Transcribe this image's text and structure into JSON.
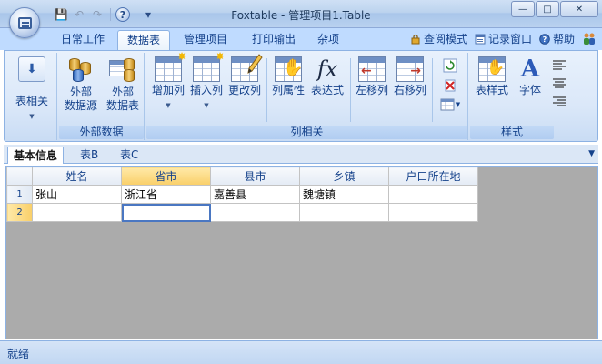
{
  "window": {
    "title": "Foxtable - 管理项目1.Table"
  },
  "window_buttons": {
    "minimize": "—",
    "maximize": "□",
    "close": "✕"
  },
  "qat": {
    "save": "💾",
    "undo": "↶",
    "redo": "↷",
    "help": "?",
    "dropdown": "▾"
  },
  "tabs": [
    {
      "label": "日常工作"
    },
    {
      "label": "数据表"
    },
    {
      "label": "管理项目"
    },
    {
      "label": "打印输出"
    },
    {
      "label": "杂项"
    }
  ],
  "right_links": [
    {
      "label": "查阅模式",
      "icon": "lock-icon"
    },
    {
      "label": "记录窗口",
      "icon": "record-window-icon"
    },
    {
      "label": "帮助",
      "icon": "help-icon"
    }
  ],
  "ribbon": {
    "table_related": {
      "label": "表相关"
    },
    "external": {
      "group_label": "外部数据",
      "source_line1": "外部",
      "source_line2": "数据源",
      "table_line1": "外部",
      "table_line2": "数据表"
    },
    "columns": {
      "group_label": "列相关",
      "add": "增加列",
      "insert": "插入列",
      "modify": "更改列",
      "props": "列属性",
      "expr": "表达式",
      "left": "左移列",
      "right": "右移列",
      "expr_glyph": "fx"
    },
    "style": {
      "group_label": "样式",
      "table_style": "表样式",
      "font": "字体",
      "font_glyph": "A"
    }
  },
  "sheet_tabs": [
    {
      "label": "基本信息"
    },
    {
      "label": "表B"
    },
    {
      "label": "表C"
    }
  ],
  "grid": {
    "columns": [
      "姓名",
      "省市",
      "县市",
      "乡镇",
      "户口所在地"
    ],
    "rows": [
      {
        "num": "1",
        "cells": [
          "张山",
          "浙江省",
          "嘉善县",
          "魏塘镇",
          ""
        ]
      },
      {
        "num": "2",
        "cells": [
          "",
          "",
          "",
          "",
          ""
        ]
      }
    ]
  },
  "status": {
    "text": "就绪"
  }
}
